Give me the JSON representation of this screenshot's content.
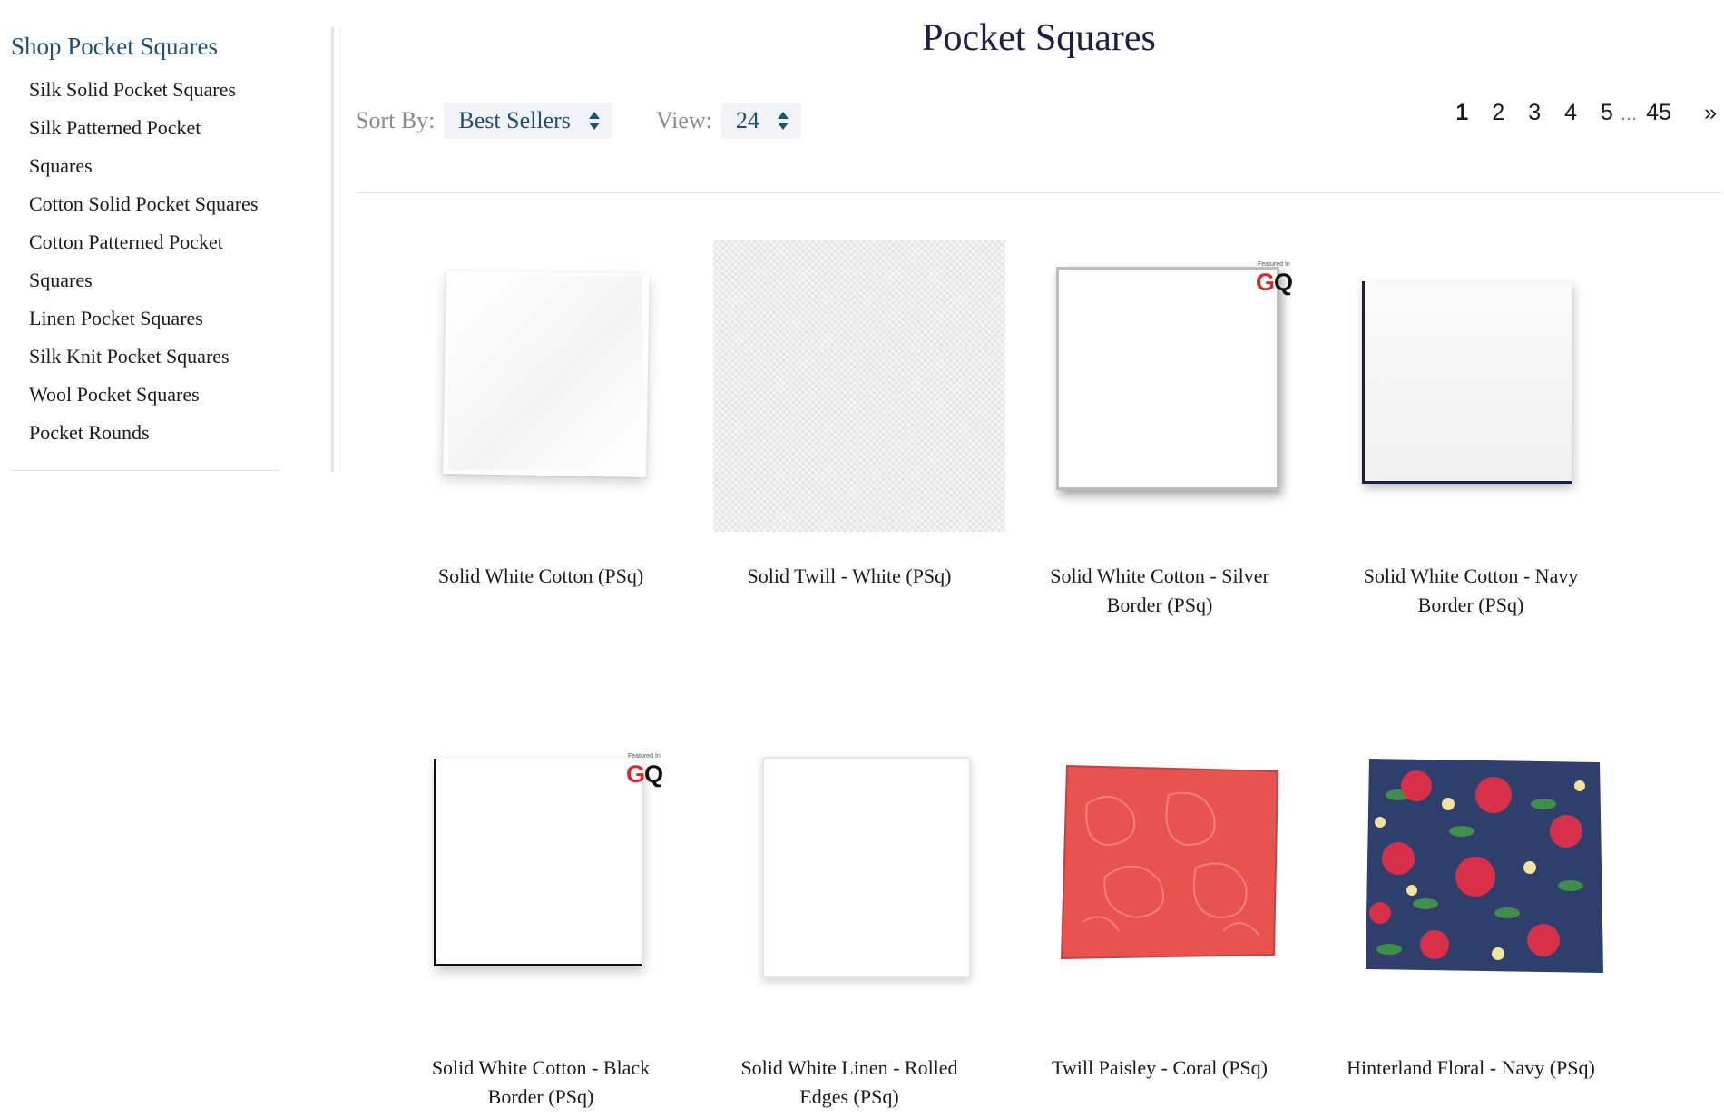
{
  "sidebar": {
    "title": "Shop Pocket Squares",
    "items": [
      {
        "label": "Silk Solid Pocket Squares"
      },
      {
        "label": "Silk Patterned Pocket"
      },
      {
        "label": "Squares"
      },
      {
        "label": "Cotton Solid Pocket Squares"
      },
      {
        "label": "Cotton Patterned Pocket"
      },
      {
        "label": "Squares"
      },
      {
        "label": "Linen Pocket Squares"
      },
      {
        "label": "Silk Knit Pocket Squares"
      },
      {
        "label": "Wool Pocket Squares"
      },
      {
        "label": "Pocket Rounds"
      }
    ]
  },
  "header": {
    "title": "Pocket Squares"
  },
  "toolbar": {
    "sort_label": "Sort By:",
    "sort_value": "Best Sellers",
    "view_label": "View:",
    "view_value": "24"
  },
  "pagination": {
    "pages": [
      "1",
      "2",
      "3",
      "4",
      "5"
    ],
    "current": "1",
    "ellipsis": "...",
    "last": "45",
    "next": "»"
  },
  "products": [
    {
      "name_line1": "Solid White Cotton (PSq)",
      "name_line2": ""
    },
    {
      "name_line1": "Solid Twill - White (PSq)",
      "name_line2": ""
    },
    {
      "name_line1": "Solid White Cotton - Silver",
      "name_line2": "Border (PSq)",
      "badge": "Featured In GQ"
    },
    {
      "name_line1": "Solid White Cotton - Navy",
      "name_line2": "Border (PSq)"
    },
    {
      "name_line1": "Solid White Cotton - Black",
      "name_line2": "Border (PSq)",
      "badge": "Featured In GQ"
    },
    {
      "name_line1": "Solid White Linen - Rolled",
      "name_line2": "Edges (PSq)"
    },
    {
      "name_line1": "Twill Paisley - Coral (PSq)",
      "name_line2": ""
    },
    {
      "name_line1": "Hinterland Floral - Navy (PSq)",
      "name_line2": ""
    }
  ],
  "badge": {
    "small_text": "Featured In",
    "g": "G",
    "q": "Q"
  },
  "colors": {
    "link_blue": "#1f4e79",
    "title_navy": "#1b1f4a",
    "coral": "#e8534f",
    "floral_navy": "#2e3f6b",
    "rose": "#d9304a",
    "leaf": "#3f8f4a",
    "daisy": "#f1e3a0"
  }
}
